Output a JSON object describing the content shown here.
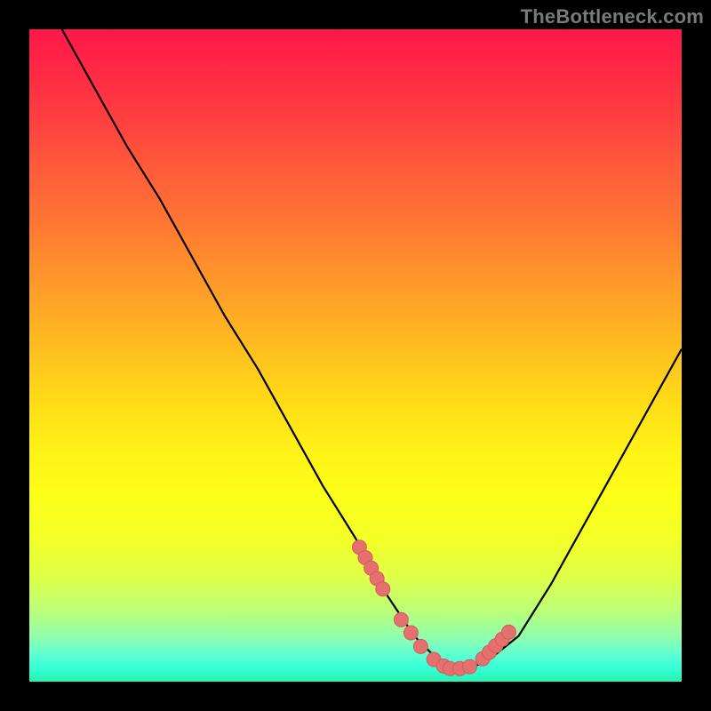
{
  "watermark": "TheBottleneck.com",
  "colors": {
    "curve_stroke": "#000000",
    "marker_fill": "#e47070",
    "marker_stroke": "#d85a5a"
  },
  "chart_data": {
    "type": "line",
    "title": "",
    "xlabel": "",
    "ylabel": "",
    "xlim": [
      0,
      100
    ],
    "ylim": [
      0,
      100
    ],
    "grid": false,
    "series": [
      {
        "name": "curve",
        "x": [
          5,
          10,
          15,
          20,
          25,
          30,
          35,
          40,
          45,
          50,
          55,
          57,
          59,
          61,
          63,
          65,
          67,
          70,
          75,
          80,
          85,
          90,
          95,
          100
        ],
        "y": [
          100,
          91,
          82,
          74,
          65,
          56,
          48,
          39,
          30,
          22,
          13,
          10,
          7,
          5,
          3,
          2,
          2,
          3,
          7,
          15,
          24,
          33,
          42,
          51
        ]
      }
    ],
    "markers": {
      "name": "highlight-points",
      "x": [
        50.6,
        51.5,
        52.4,
        53.3,
        54.2,
        57.0,
        58.5,
        60.0,
        62.0,
        63.5,
        64.5,
        66.0,
        67.5,
        69.5,
        70.5,
        71.5,
        72.5,
        73.5
      ],
      "y": [
        20.6,
        19.0,
        17.4,
        15.8,
        14.2,
        9.5,
        7.5,
        5.4,
        3.4,
        2.4,
        2.0,
        2.0,
        2.3,
        3.5,
        4.5,
        5.5,
        6.5,
        7.6
      ]
    }
  }
}
